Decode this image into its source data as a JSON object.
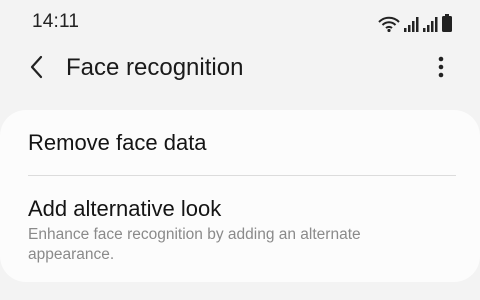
{
  "status_bar": {
    "time": "14:11",
    "icons": [
      "wifi-icon",
      "signal-icon",
      "signal-icon",
      "battery-icon"
    ]
  },
  "header": {
    "back_icon": "chevron-left-icon",
    "title": "Face recognition",
    "more_icon": "more-vertical-icon"
  },
  "settings": {
    "items": [
      {
        "title": "Remove face data"
      },
      {
        "title": "Add alternative look",
        "subtitle": "Enhance face recognition by adding an alternate appearance."
      }
    ]
  },
  "colors": {
    "background": "#f3f3f3",
    "card": "#fcfcfc",
    "subtitle": "#8a8a8a",
    "divider": "#dcdcdc"
  }
}
